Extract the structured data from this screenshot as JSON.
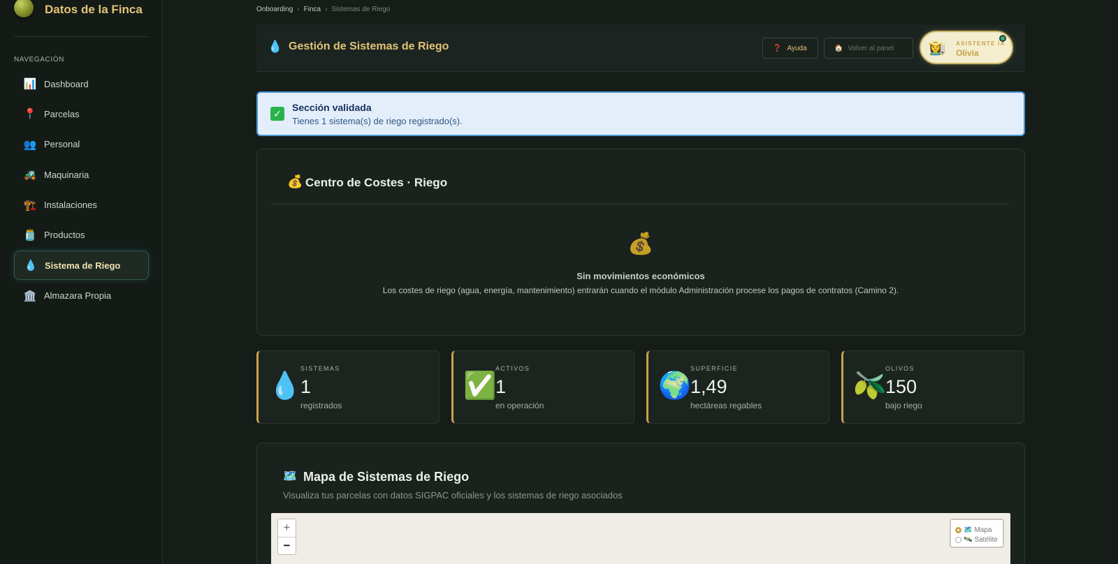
{
  "sidebar": {
    "brand_title": "Datos de la Finca",
    "nav_heading": "NAVEGACIÓN",
    "items": [
      {
        "icon": "📊",
        "label": "Dashboard"
      },
      {
        "icon": "📍",
        "label": "Parcelas"
      },
      {
        "icon": "👥",
        "label": "Personal"
      },
      {
        "icon": "🚜",
        "label": "Maquinaria"
      },
      {
        "icon": "🏗️",
        "label": "Instalaciones"
      },
      {
        "icon": "🫙",
        "label": "Productos"
      },
      {
        "icon": "💧",
        "label": "Sistema de Riego"
      },
      {
        "icon": "🏛️",
        "label": "Almazara Propia"
      }
    ],
    "active_item": "Sistema de Riego"
  },
  "breadcrumb": [
    "Onboarding",
    "Finca",
    "Sistemas de Riego"
  ],
  "header": {
    "icon": "💧",
    "title": "Gestión de Sistemas de Riego",
    "help_icon": "❓",
    "help_label": "Ayuda",
    "back_icon": "🏠",
    "back_label": "Volver al panel",
    "assistant_avatar": "👩‍🌾",
    "assistant_label": "ASISTENTE IA",
    "assistant_name": "Olivia"
  },
  "alert": {
    "icon": "✓",
    "title": "Sección validada",
    "message": "Tienes 1 sistema(s) de riego registrado(s)."
  },
  "cost_center": {
    "icon": "💰",
    "title": "Centro de Costes · Riego",
    "empty_icon": "💰",
    "empty_title": "Sin movimientos económicos",
    "empty_message": "Los costes de riego (agua, energía, mantenimiento) entrarán cuando el módulo Administración procese los pagos de contratos (Camino 2)."
  },
  "stats": [
    {
      "icon": "💧",
      "label": "SISTEMAS",
      "value": "1",
      "sub": "registrados"
    },
    {
      "icon": "✅",
      "label": "ACTIVOS",
      "value": "1",
      "sub": "en operación"
    },
    {
      "icon": "🌍",
      "label": "SUPERFICIE",
      "value": "1,49",
      "sub": "hectáreas regables"
    },
    {
      "icon": "🫒",
      "label": "OLIVOS",
      "value": "150",
      "sub": "bajo riego"
    }
  ],
  "map": {
    "icon": "🗺️",
    "title": "Mapa de Sistemas de Riego",
    "subtitle": "Visualiza tus parcelas con datos SIGPAC oficiales y los sistemas de riego asociados",
    "zoom_in": "+",
    "zoom_out": "−",
    "layers": [
      {
        "icon": "🗺️",
        "label": "Mapa",
        "selected": true
      },
      {
        "icon": "🛰️",
        "label": "Satélite",
        "selected": false
      }
    ]
  },
  "colors": {
    "accent_gold": "#e3c377",
    "alert_border": "#4a9ad5",
    "success_green": "#28b34b"
  }
}
